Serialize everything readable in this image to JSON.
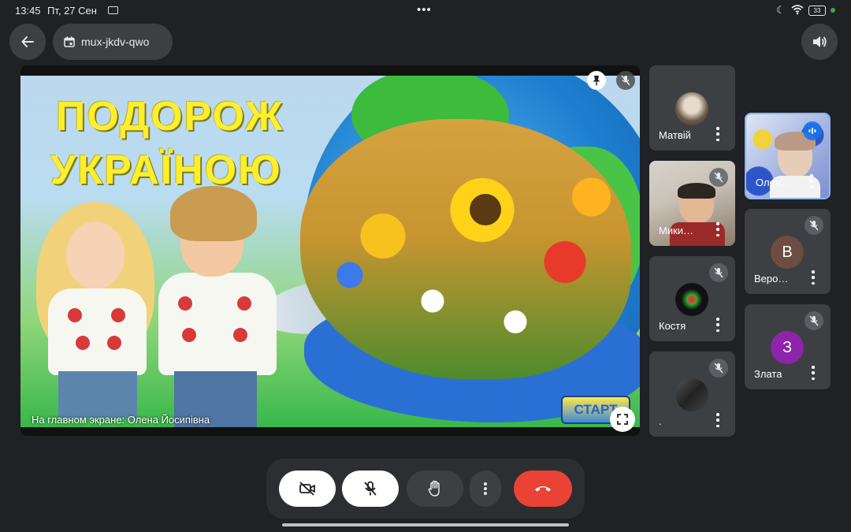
{
  "status_bar": {
    "time": "13:45",
    "date": "Пт, 27 Сен",
    "battery": "33",
    "battery_color": "#34a853"
  },
  "top_bar": {
    "meeting_code": "mux-jkdv-qwo",
    "back_icon": "arrow-left-icon",
    "calendar_icon": "calendar-icon",
    "speaker_icon": "volume-icon"
  },
  "stage": {
    "slide_title_line1": "ПОДОРОЖ",
    "slide_title_line2": "УКРАЇНОЮ",
    "start_label": "СТАРТ",
    "presenter_label": "На главном экране: Олена Йосипівна"
  },
  "participants": [
    {
      "name": "Матвій",
      "muted": false,
      "kind": "photo-avatar"
    },
    {
      "name": "Мики…",
      "muted": true,
      "kind": "video"
    },
    {
      "name": "Костя",
      "muted": true,
      "kind": "photo-avatar"
    },
    {
      "name": ".",
      "muted": true,
      "kind": "photo-avatar"
    },
    {
      "name": "Олен…",
      "muted": false,
      "speaking": true,
      "kind": "video"
    },
    {
      "name": "Веро…",
      "muted": true,
      "initial": "В",
      "avatar_color": "#6d4c41"
    },
    {
      "name": "Злата",
      "muted": true,
      "initial": "З",
      "avatar_color": "#8e24aa"
    }
  ],
  "controls": {
    "camera_icon": "camera-off-icon",
    "mic_icon": "mic-off-icon",
    "hand_icon": "raise-hand-icon",
    "more_icon": "more-vert-icon",
    "hangup_icon": "hang-up-icon",
    "hangup_color": "#ea4335"
  }
}
